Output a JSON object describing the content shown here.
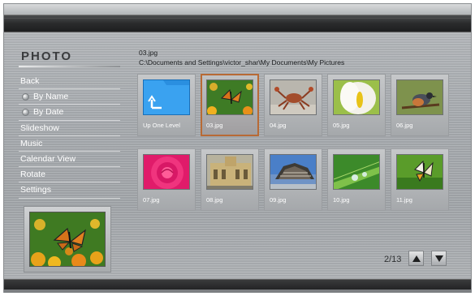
{
  "app": {
    "title": "PHOTO"
  },
  "current_file": {
    "name": "03.jpg",
    "path": "C:\\Documents and Settings\\victor_shar\\My Documents\\My Pictures"
  },
  "menu": {
    "items": [
      {
        "label": "Back",
        "sub": false
      },
      {
        "label": "By Name",
        "sub": true
      },
      {
        "label": "By Date",
        "sub": true
      },
      {
        "label": "Slideshow",
        "sub": false
      },
      {
        "label": "Music",
        "sub": false
      },
      {
        "label": "Calendar View",
        "sub": false
      },
      {
        "label": "Rotate",
        "sub": false
      },
      {
        "label": "Settings",
        "sub": false
      }
    ]
  },
  "tiles": [
    {
      "label": "Up One Level",
      "icon": "folder-up-icon",
      "selected": false
    },
    {
      "label": "03.jpg",
      "icon": "butterfly-thumbnail",
      "selected": true
    },
    {
      "label": "04.jpg",
      "icon": "crab-thumbnail",
      "selected": false
    },
    {
      "label": "05.jpg",
      "icon": "lily-thumbnail",
      "selected": false
    },
    {
      "label": "06.jpg",
      "icon": "bird-thumbnail",
      "selected": false
    },
    {
      "label": "07.jpg",
      "icon": "rose-thumbnail",
      "selected": false
    },
    {
      "label": "08.jpg",
      "icon": "palace-thumbnail",
      "selected": false
    },
    {
      "label": "09.jpg",
      "icon": "building-thumbnail",
      "selected": false
    },
    {
      "label": "10.jpg",
      "icon": "waterdrop-leaf-thumbnail",
      "selected": false
    },
    {
      "label": "11.jpg",
      "icon": "butterfly2-thumbnail",
      "selected": false
    }
  ],
  "pager": {
    "text": "2/13",
    "up_icon": "triangle-up-icon",
    "down_icon": "triangle-down-icon"
  },
  "colors": {
    "selection": "#b86a35",
    "menu_text": "#ffffff",
    "folder": "#2a8fe0"
  }
}
